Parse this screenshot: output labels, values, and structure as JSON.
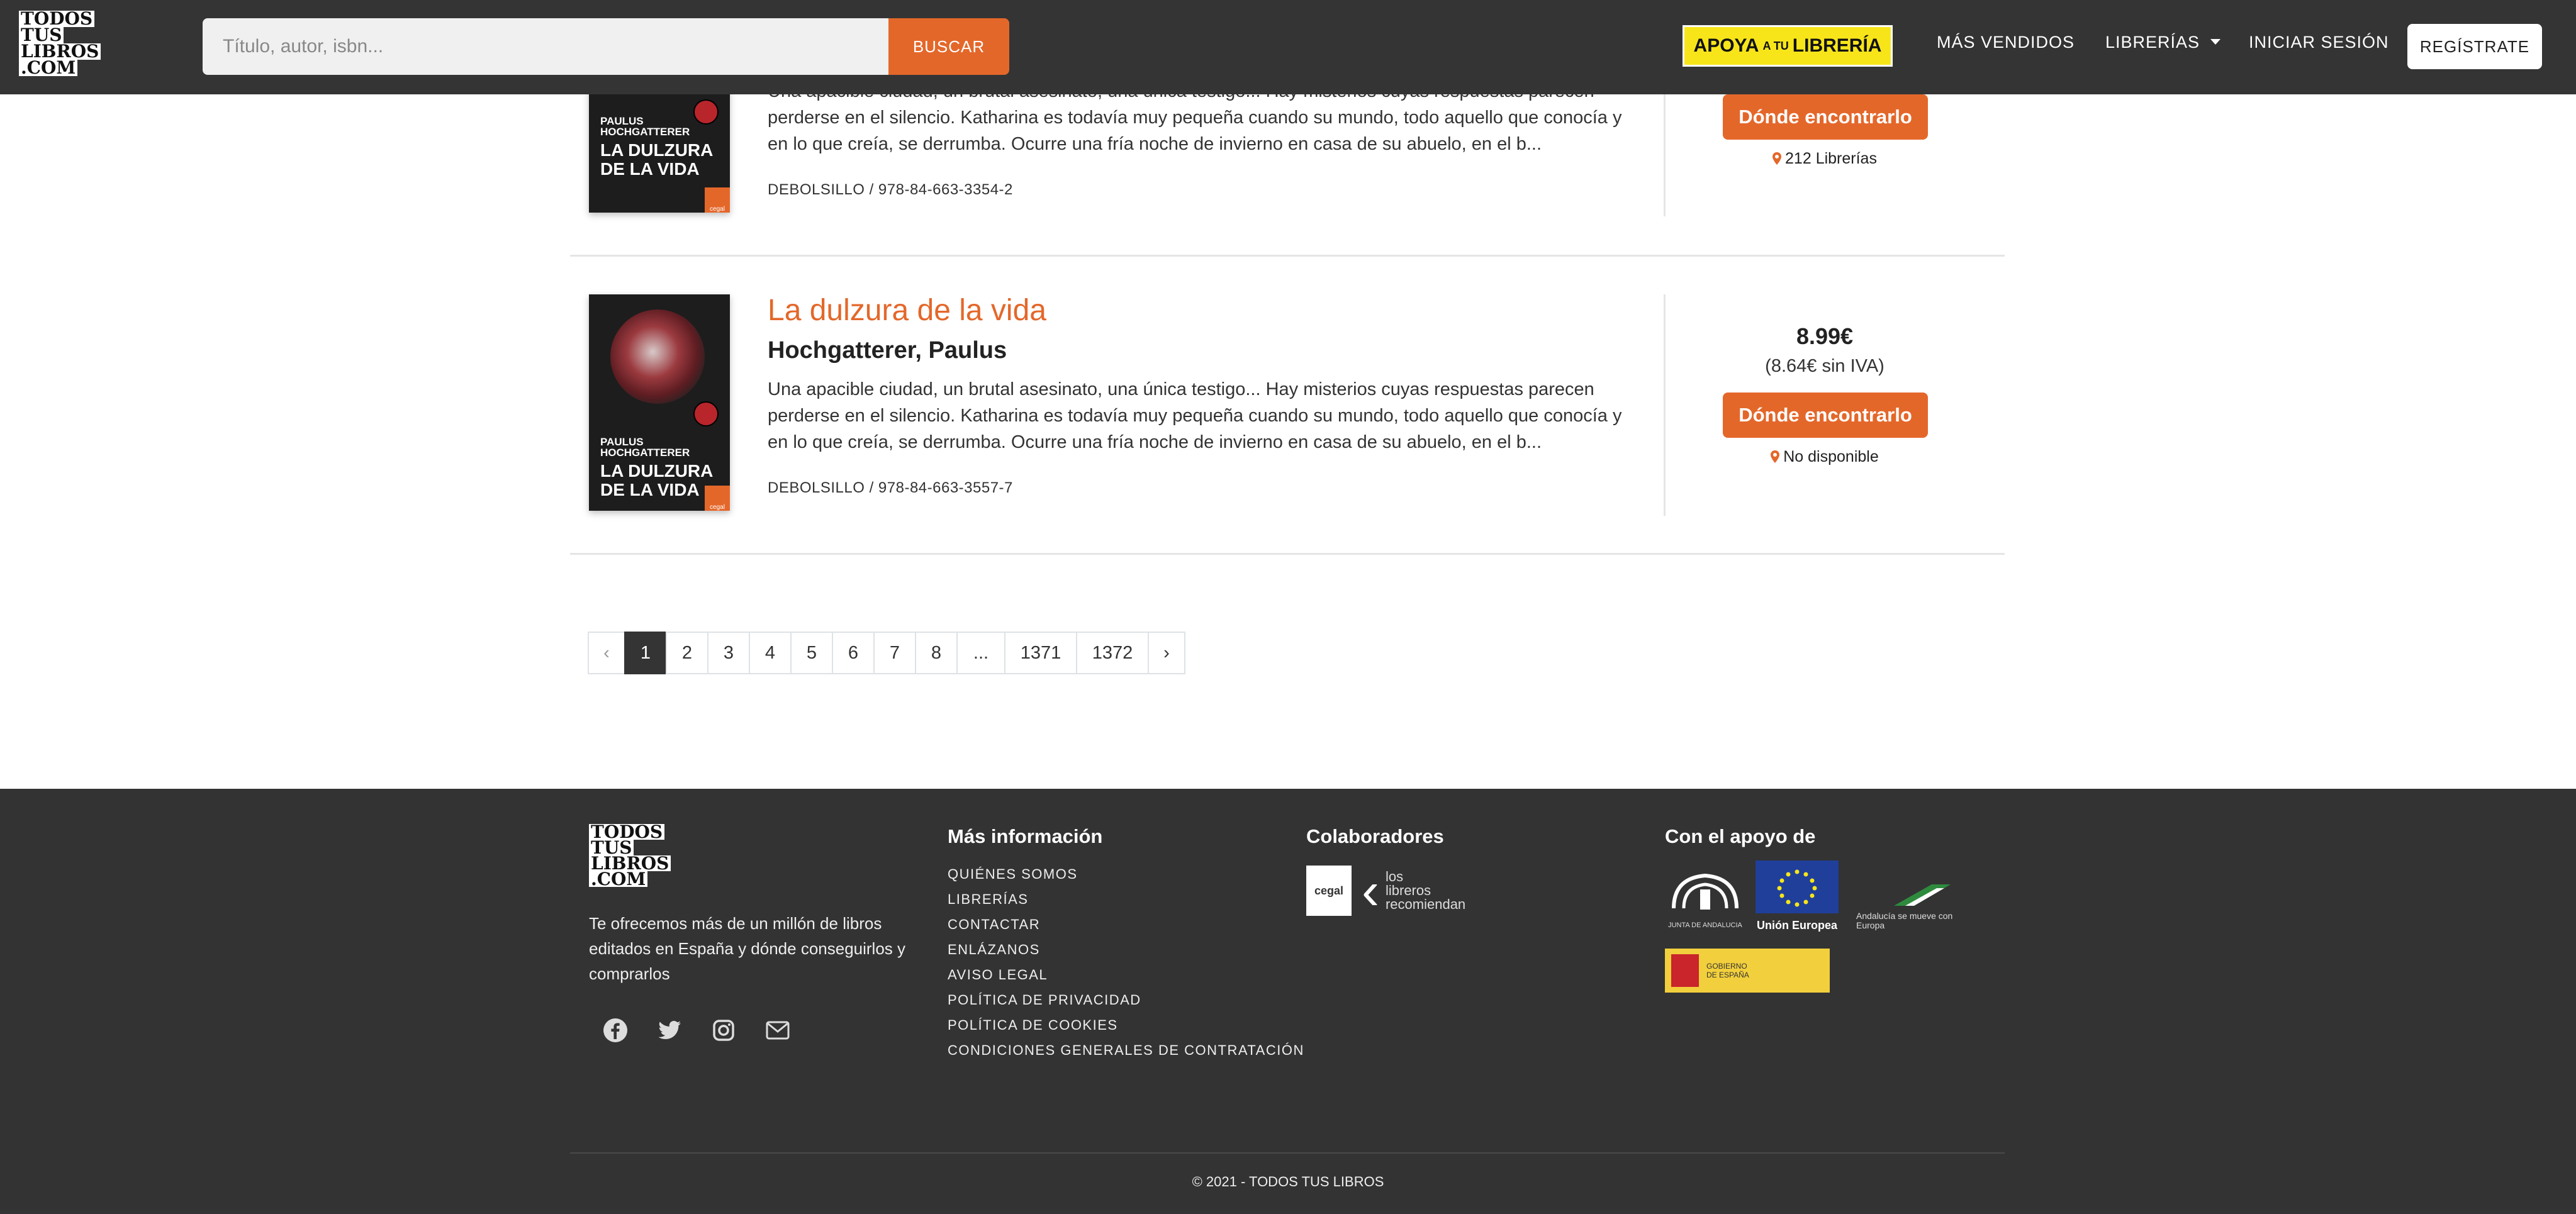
{
  "header": {
    "logo_lines": [
      "TODOS",
      "TUS",
      "LIBROS",
      ".COM"
    ],
    "search_placeholder": "Título, autor, isbn...",
    "search_button": "BUSCAR",
    "apoya_left": "APOYA",
    "apoya_mid": "A TU",
    "apoya_right": "LIBRERÍA",
    "nav_mas_vendidos": "MÁS VENDIDOS",
    "nav_librerias": "LIBRERÍAS",
    "nav_iniciar": "INICIAR SESIÓN",
    "nav_registrate": "REGÍSTRATE"
  },
  "books": [
    {
      "cover_author": "PAULUS HOCHGATTERER",
      "cover_title": "LA DULZURA DE LA VIDA",
      "description": "Una apacible ciudad, un brutal asesinato, una única testigo... Hay misterios cuyas respuestas parecen perderse en el silencio. Katharina es todavía muy pequeña cuando su mundo, todo aquello que conocía y en lo que creía, se derrumba. Ocurre una fría noche de invierno en casa de su abuelo, en el b...",
      "meta": "DEBOLSILLO / 978-84-663-3354-2",
      "button": "Dónde encontrarlo",
      "availability": "212 Librerías"
    },
    {
      "cover_author": "PAULUS HOCHGATTERER",
      "cover_title": "LA DULZURA DE LA VIDA",
      "title": "La dulzura de la vida",
      "author": "Hochgatterer, Paulus",
      "description": "Una apacible ciudad, un brutal asesinato, una única testigo... Hay misterios cuyas respuestas parecen perderse en el silencio. Katharina es todavía muy pequeña cuando su mundo, todo aquello que conocía y en lo que creía, se derrumba. Ocurre una fría noche de invierno en casa de su abuelo, en el b...",
      "meta": "DEBOLSILLO / 978-84-663-3557-7",
      "price": "8.99€",
      "price_no_iva": "(8.64€ sin IVA)",
      "button": "Dónde encontrarlo",
      "availability": "No disponible"
    }
  ],
  "pagination": {
    "prev": "‹",
    "pages": [
      "1",
      "2",
      "3",
      "4",
      "5",
      "6",
      "7",
      "8",
      "...",
      "1371",
      "1372"
    ],
    "next": "›",
    "active": "1"
  },
  "footer": {
    "logo_lines": [
      "TODOS",
      "TUS",
      "LIBROS",
      ".COM"
    ],
    "description": "Te ofrecemos más de un millón de libros editados en España y dónde conseguirlos y comprarlos",
    "mas_info_heading": "Más información",
    "links": [
      "QUIÉNES SOMOS",
      "LIBRERÍAS",
      "CONTACTAR",
      "ENLÁZANOS",
      "AVISO LEGAL",
      "POLÍTICA DE PRIVACIDAD",
      "POLÍTICA DE COOKIES",
      "CONDICIONES GENERALES DE CONTRATACIÓN"
    ],
    "colaboradores_heading": "Colaboradores",
    "cegal_label": "cegal",
    "libreros_lines": [
      "los",
      "libreros",
      "recomiendan"
    ],
    "apoyo_heading": "Con el apoyo de",
    "junta_label": "JUNTA DE ANDALUCIA",
    "ue_label": "Unión Europea",
    "andalucia_label": "Andalucía se mueve con Europa",
    "gobierno_label": "GOBIERNO DE ESPAÑA",
    "copyright": "© 2021 - TODOS TUS LIBROS"
  },
  "colors": {
    "accent": "#e4672a",
    "dark": "#343434",
    "footer": "#333333"
  },
  "icons": [
    "facebook-icon",
    "twitter-icon",
    "instagram-icon",
    "envelope-icon",
    "map-pin-icon",
    "caret-down-icon"
  ]
}
